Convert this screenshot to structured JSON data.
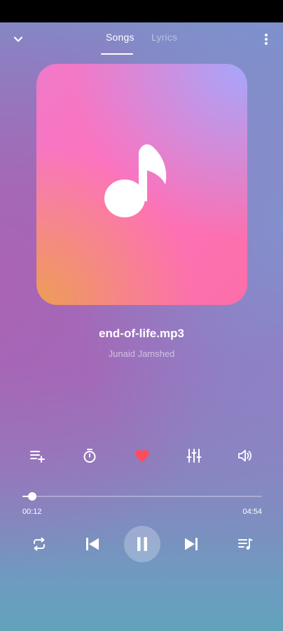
{
  "tabs": {
    "songs": "Songs",
    "lyrics": "Lyrics"
  },
  "track": {
    "title": "end-of-life.mp3",
    "artist": "Junaid Jamshed"
  },
  "progress": {
    "elapsed": "00:12",
    "total": "04:54",
    "fraction": 0.041
  },
  "colors": {
    "favorite": "#ff4d5e",
    "album_pink": "#ff71bd",
    "album_orange": "#eca050",
    "album_lavender": "#a0aaff"
  },
  "icons": {
    "collapse": "chevron-down-icon",
    "more": "more-vertical-icon",
    "album": "music-note-icon",
    "add_to_playlist": "playlist-add-icon",
    "sleep_timer": "timer-icon",
    "favorite": "heart-icon",
    "equalizer": "equalizer-icon",
    "volume": "volume-icon",
    "repeat": "repeat-icon",
    "previous": "skip-previous-icon",
    "pause": "pause-icon",
    "next": "skip-next-icon",
    "queue": "queue-music-icon"
  }
}
